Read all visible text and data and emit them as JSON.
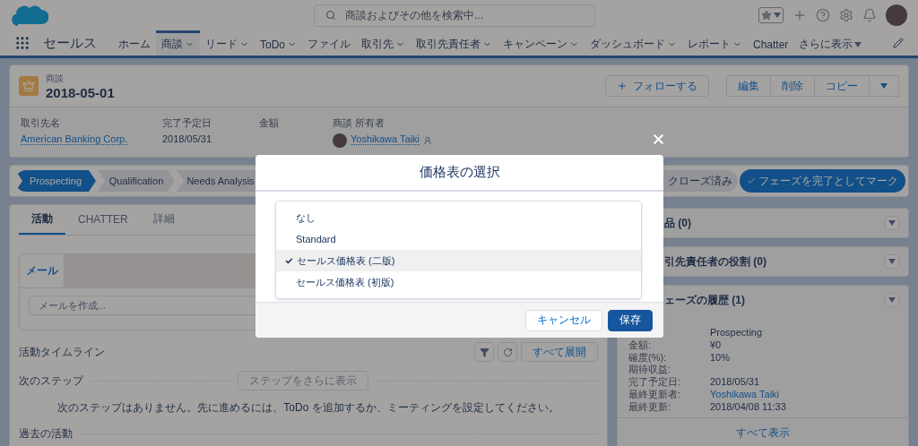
{
  "global_header": {
    "search": {
      "placeholder": "商談およびその他を検索中..."
    }
  },
  "nav": {
    "app_name": "セールス",
    "tabs": [
      {
        "label": "ホーム",
        "selected": false,
        "has_menu": false
      },
      {
        "label": "商談",
        "selected": true,
        "has_menu": true
      },
      {
        "label": "リード",
        "selected": false,
        "has_menu": true
      },
      {
        "label": "ToDo",
        "selected": false,
        "has_menu": true
      },
      {
        "label": "ファイル",
        "selected": false,
        "has_menu": false
      },
      {
        "label": "取引先",
        "selected": false,
        "has_menu": true
      },
      {
        "label": "取引先責任者",
        "selected": false,
        "has_menu": true
      },
      {
        "label": "キャンペーン",
        "selected": false,
        "has_menu": true
      },
      {
        "label": "ダッシュボード",
        "selected": false,
        "has_menu": true
      },
      {
        "label": "レポート",
        "selected": false,
        "has_menu": true
      },
      {
        "label": "Chatter",
        "selected": false,
        "has_menu": false
      }
    ],
    "more": "さらに表示"
  },
  "record": {
    "object_label": "商談",
    "title": "2018-05-01",
    "follow": "フォローする",
    "actions": [
      "編集",
      "削除",
      "コピー"
    ],
    "fields": [
      {
        "label": "取引先名",
        "value": "American Banking Corp.",
        "kind": "link"
      },
      {
        "label": "完了予定日",
        "value": "2018/05/31",
        "kind": "text"
      },
      {
        "label": "金額",
        "kind": "text"
      },
      {
        "label": "商談 所有者",
        "value": "Yoshikawa Taiki",
        "kind": "owner"
      }
    ]
  },
  "path": {
    "stages": [
      {
        "label": "Prospecting",
        "current": true
      },
      {
        "label": "Qualification",
        "current": false
      },
      {
        "label": "Needs Analysis",
        "current": false
      },
      {
        "label": "クローズ済み",
        "current": false
      }
    ],
    "mark_button": "フェーズを完了としてマーク"
  },
  "activity": {
    "tabs": [
      {
        "label": "活動",
        "selected": true
      },
      {
        "label": "CHATTER",
        "selected": false
      },
      {
        "label": "詳細",
        "selected": false
      }
    ],
    "composer": {
      "tab": "メール",
      "placeholder": "メールを作成..."
    },
    "timeline_title": "活動タイムライン",
    "expand_all": "すべて展開",
    "next_steps": "次のステップ",
    "more_steps": "ステップをさらに表示",
    "empty_message": "次のステップはありません。先に進めるには、ToDo を追加するか、ミーティングを設定してください。",
    "past_activities": "過去の活動"
  },
  "related": [
    {
      "title": "品 (0)"
    },
    {
      "title": "引先責任者の役割 (0)"
    },
    {
      "title": "ェーズの履歴 (1)",
      "rows": [
        {
          "value": "Prospecting",
          "kind": "text"
        },
        {
          "label": "金額:",
          "value": "¥0",
          "kind": "text"
        },
        {
          "label": "確度(%):",
          "value": "10%",
          "kind": "text"
        },
        {
          "label": "期待収益:"
        },
        {
          "label": "完了予定日:",
          "value": "2018/05/31",
          "kind": "text"
        },
        {
          "label": "最終更新者:",
          "value": "Yoshikawa Taiki",
          "kind": "link"
        },
        {
          "label": "最終更新:",
          "value": "2018/04/08 11:33",
          "kind": "text"
        }
      ],
      "view_all": "すべて表示"
    }
  ],
  "modal": {
    "title": "価格表の選択",
    "options": [
      {
        "label": "なし",
        "selected": false
      },
      {
        "label": "Standard",
        "selected": false
      },
      {
        "label": "セールス価格表 (二版)",
        "selected": true
      },
      {
        "label": "セールス価格表 (初版)",
        "selected": false
      }
    ],
    "cancel": "キャンセル",
    "save": "保存"
  }
}
